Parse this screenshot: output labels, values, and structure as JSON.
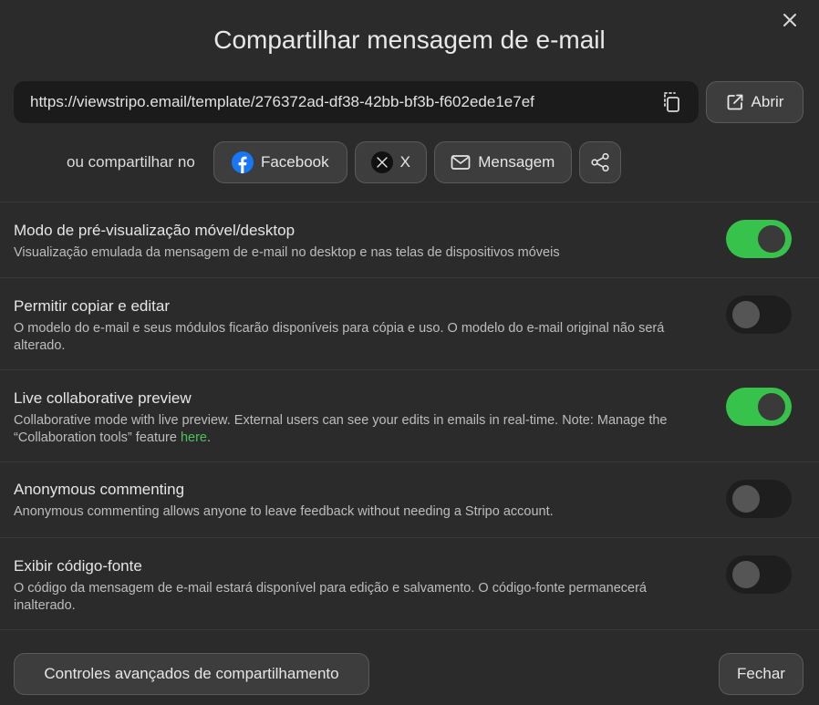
{
  "dialog": {
    "title": "Compartilhar mensagem de e-mail",
    "close_icon": "close-icon"
  },
  "url_section": {
    "url": "https://viewstripo.email/template/276372ad-df38-42bb-bf3b-f602ede1e7ef",
    "copy_icon": "copy-icon",
    "open_label": "Abrir",
    "open_icon": "external-link-icon"
  },
  "share": {
    "label": "ou compartilhar no",
    "facebook_label": "Facebook",
    "x_label": "X",
    "message_label": "Mensagem",
    "share_icon": "share-icon",
    "facebook_color": "#1877f2"
  },
  "settings": [
    {
      "title": "Modo de pré-visualização móvel/desktop",
      "description": "Visualização emulada da mensagem de e-mail no desktop e nas telas de dispositivos móveis",
      "enabled": true
    },
    {
      "title": "Permitir copiar e editar",
      "description": "O modelo do e-mail e seus módulos ficarão disponíveis para cópia e uso. O modelo do e-mail original não será alterado.",
      "enabled": false
    },
    {
      "title": "Live collaborative preview",
      "description": "Collaborative mode with live preview. External users can see your edits in emails in real-time. Note: Manage the “Collaboration tools” feature ",
      "link_text": "here",
      "description_suffix": ".",
      "enabled": true
    },
    {
      "title": "Anonymous commenting",
      "description": "Anonymous commenting allows anyone to leave feedback without needing a Stripo account.",
      "enabled": false
    },
    {
      "title": "Exibir código-fonte",
      "description": "O código da mensagem de e-mail estará disponível para edição e salvamento. O código-fonte permanecerá inalterado.",
      "enabled": false
    }
  ],
  "footer": {
    "advanced_label": "Controles avançados de compartilhamento",
    "close_label": "Fechar"
  },
  "colors": {
    "accent_green": "#36c24b",
    "background": "#2b2b2b"
  }
}
